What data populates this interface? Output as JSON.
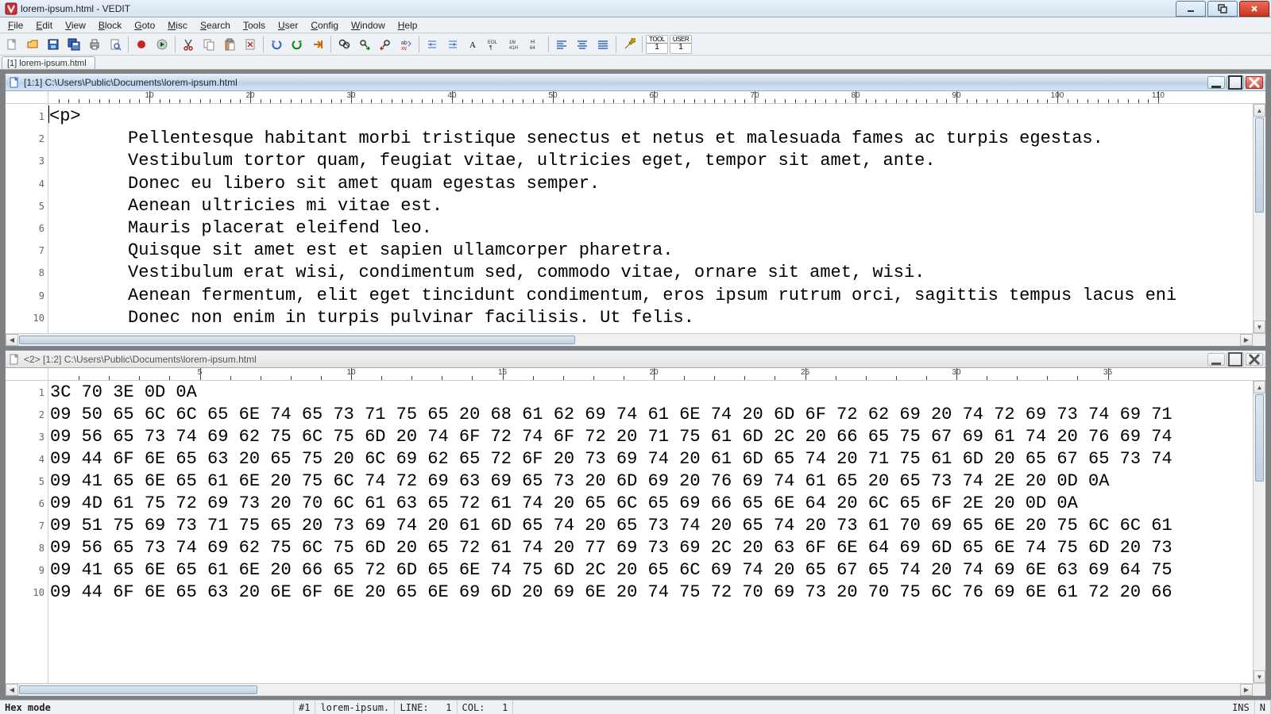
{
  "window": {
    "title": "lorem-ipsum.html - VEDIT"
  },
  "menus": [
    "File",
    "Edit",
    "View",
    "Block",
    "Goto",
    "Misc",
    "Search",
    "Tools",
    "User",
    "Config",
    "Window",
    "Help"
  ],
  "buffer_tab": "[1] lorem-ipsum.html",
  "pane1": {
    "title": "[1:1]  C:\\Users\\Public\\Documents\\lorem-ipsum.html",
    "ruler_step": 10,
    "ruler_max": 110,
    "lines": [
      {
        "n": 1,
        "text": "<p>",
        "indent": 0,
        "caret_before": true
      },
      {
        "n": 2,
        "text": "Pellentesque habitant morbi tristique senectus et netus et malesuada fames ac turpis egestas.",
        "indent": 1
      },
      {
        "n": 3,
        "text": "Vestibulum tortor quam, feugiat vitae, ultricies eget, tempor sit amet, ante.",
        "indent": 1
      },
      {
        "n": 4,
        "text": "Donec eu libero sit amet quam egestas semper.",
        "indent": 1
      },
      {
        "n": 5,
        "text": "Aenean ultricies mi vitae est.",
        "indent": 1
      },
      {
        "n": 6,
        "text": "Mauris placerat eleifend leo.",
        "indent": 1
      },
      {
        "n": 7,
        "text": "Quisque sit amet est et sapien ullamcorper pharetra.",
        "indent": 1
      },
      {
        "n": 8,
        "text": "Vestibulum erat wisi, condimentum sed, commodo vitae, ornare sit amet, wisi.",
        "indent": 1
      },
      {
        "n": 9,
        "text": "Aenean fermentum, elit eget tincidunt condimentum, eros ipsum rutrum orci, sagittis tempus lacus eni",
        "indent": 1
      },
      {
        "n": 10,
        "text": "Donec non enim in turpis pulvinar facilisis. Ut felis.",
        "indent": 1
      }
    ]
  },
  "pane2": {
    "title": "<2> [1:2]  C:\\Users\\Public\\Documents\\lorem-ipsum.html",
    "ruler_step": 5,
    "ruler_max": 35,
    "hexlines": [
      {
        "n": 1,
        "hex": "3C 70 3E 0D 0A"
      },
      {
        "n": 2,
        "hex": "09 50 65 6C 6C 65 6E 74 65 73 71 75 65 20 68 61 62 69 74 61 6E 74 20 6D 6F 72 62 69 20 74 72 69 73 74 69 71"
      },
      {
        "n": 3,
        "hex": "09 56 65 73 74 69 62 75 6C 75 6D 20 74 6F 72 74 6F 72 20 71 75 61 6D 2C 20 66 65 75 67 69 61 74 20 76 69 74"
      },
      {
        "n": 4,
        "hex": "09 44 6F 6E 65 63 20 65 75 20 6C 69 62 65 72 6F 20 73 69 74 20 61 6D 65 74 20 71 75 61 6D 20 65 67 65 73 74"
      },
      {
        "n": 5,
        "hex": "09 41 65 6E 65 61 6E 20 75 6C 74 72 69 63 69 65 73 20 6D 69 20 76 69 74 61 65 20 65 73 74 2E 20 0D 0A"
      },
      {
        "n": 6,
        "hex": "09 4D 61 75 72 69 73 20 70 6C 61 63 65 72 61 74 20 65 6C 65 69 66 65 6E 64 20 6C 65 6F 2E 20 0D 0A"
      },
      {
        "n": 7,
        "hex": "09 51 75 69 73 71 75 65 20 73 69 74 20 61 6D 65 74 20 65 73 74 20 65 74 20 73 61 70 69 65 6E 20 75 6C 6C 61"
      },
      {
        "n": 8,
        "hex": "09 56 65 73 74 69 62 75 6C 75 6D 20 65 72 61 74 20 77 69 73 69 2C 20 63 6F 6E 64 69 6D 65 6E 74 75 6D 20 73"
      },
      {
        "n": 9,
        "hex": "09 41 65 6E 65 61 6E 20 66 65 72 6D 65 6E 74 75 6D 2C 20 65 6C 69 74 20 65 67 65 74 20 74 69 6E 63 69 64 75"
      },
      {
        "n": 10,
        "hex": "09 44 6F 6E 65 63 20 6E 6F 6E 20 65 6E 69 6D 20 69 6E 20 74 75 72 70 69 73 20 70 75 6C 76 69 6E 61 72 20 66"
      }
    ]
  },
  "status": {
    "mode": "Hex mode",
    "buf": "#1",
    "file": "lorem-ipsum.",
    "line_label": "LINE:",
    "line": "1",
    "col_label": "COL:",
    "col": "1",
    "ins": "INS",
    "n": "N"
  },
  "tool_text": {
    "tool": "TOOL",
    "user": "USER",
    "one": "1"
  }
}
